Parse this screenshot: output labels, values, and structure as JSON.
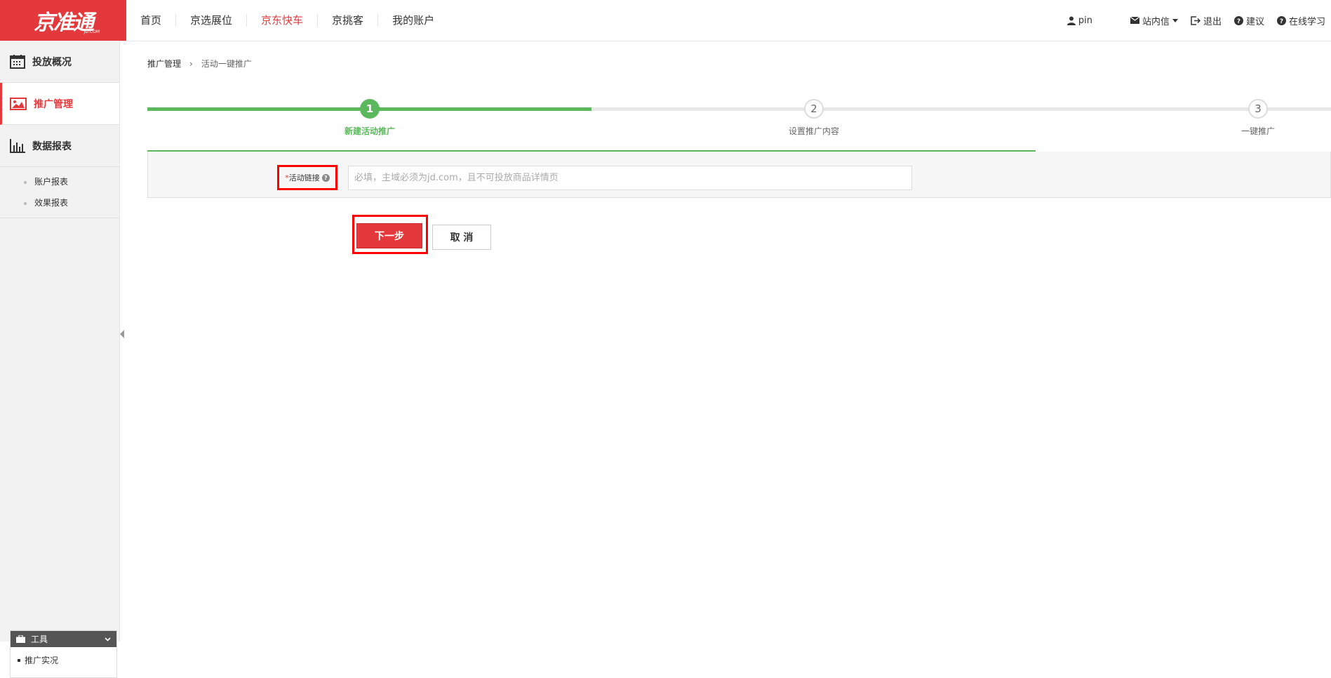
{
  "app": {
    "logo_text": "京准通",
    "logo_sub": "JD.COM"
  },
  "nav": {
    "items": [
      {
        "label": "首页"
      },
      {
        "label": "京选展位"
      },
      {
        "label": "京东快车"
      },
      {
        "label": "京挑客"
      },
      {
        "label": "我的账户"
      }
    ],
    "active": "京东快车"
  },
  "top_right": {
    "user": "pin",
    "messages": "站内信",
    "logout": "退出",
    "suggest": "建议",
    "learn": "在线学习"
  },
  "sidebar": {
    "items": [
      {
        "label": "投放概况",
        "icon": "calendar-icon"
      },
      {
        "label": "推广管理",
        "icon": "image-icon"
      },
      {
        "label": "数据报表",
        "icon": "bar-chart-icon"
      }
    ],
    "active": "推广管理",
    "sub_items": [
      {
        "label": "账户报表"
      },
      {
        "label": "效果报表"
      }
    ],
    "tools": {
      "title": "工具",
      "items": [
        {
          "label": "推广实况"
        }
      ]
    }
  },
  "breadcrumb": {
    "parent": "推广管理",
    "current": "活动一键推广"
  },
  "steps": [
    {
      "number": "1",
      "label": "新建活动推广",
      "status": "done"
    },
    {
      "number": "2",
      "label": "设置推广内容",
      "status": "todo"
    },
    {
      "number": "3",
      "label": "一键推广",
      "status": "todo"
    }
  ],
  "form": {
    "required_mark": "*",
    "label": "活动链接",
    "help": "?",
    "input_value": "",
    "input_placeholder": "必填，主域必须为jd.com，且不可投放商品详情页"
  },
  "buttons": {
    "next": "下一步",
    "cancel": "取 消"
  },
  "colors": {
    "brand": "#e4393c",
    "success": "#5cb85c"
  }
}
